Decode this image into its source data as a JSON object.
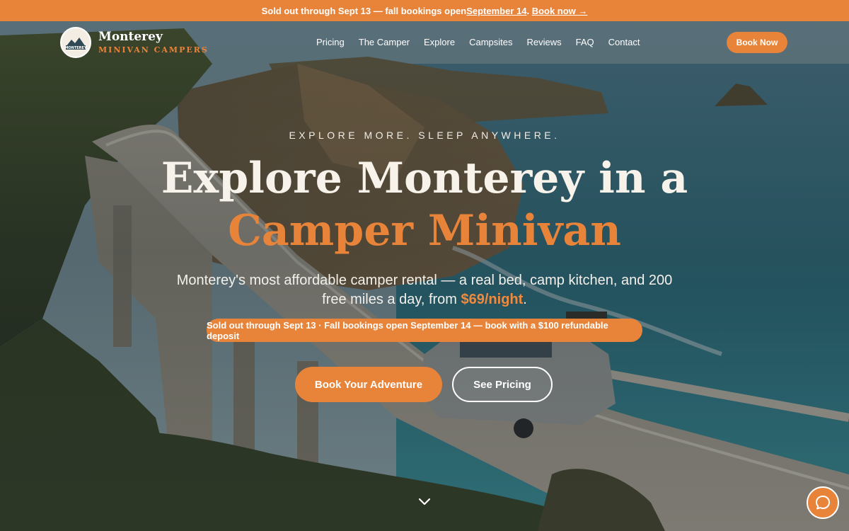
{
  "announcement": {
    "prefix": "Sold out through Sept 13 — fall bookings open ",
    "date_link": "September 14",
    "separator": ". ",
    "book_link": "Book now →"
  },
  "nav": {
    "logo_name": "Monterey",
    "logo_sub": "MINIVAN CAMPERS",
    "logo_badge_text": "MONTEREY",
    "items": [
      "Pricing",
      "The Camper",
      "Explore",
      "Campsites",
      "Reviews",
      "FAQ",
      "Contact"
    ],
    "book_now": "Book Now"
  },
  "hero": {
    "eyebrow": "EXPLORE MORE. SLEEP ANYWHERE.",
    "headline_line1": "Explore Monterey in a",
    "headline_line2": "Camper Minivan",
    "sub_text": "Monterey's most affordable camper rental — a real bed, camp kitchen, and 200 free miles a day, from ",
    "sub_price": "$69/night",
    "sub_end": ".",
    "notice": "Sold out through Sept 13 · Fall bookings open September 14 — book with a $100 refundable deposit",
    "cta_primary": "Book Your Adventure",
    "cta_secondary": "See Pricing"
  },
  "icons": {
    "scroll": "chevron-down-icon",
    "chat": "chat-bubble-icon"
  },
  "colors": {
    "accent": "#e8843a",
    "headline": "#f7f2ea"
  }
}
